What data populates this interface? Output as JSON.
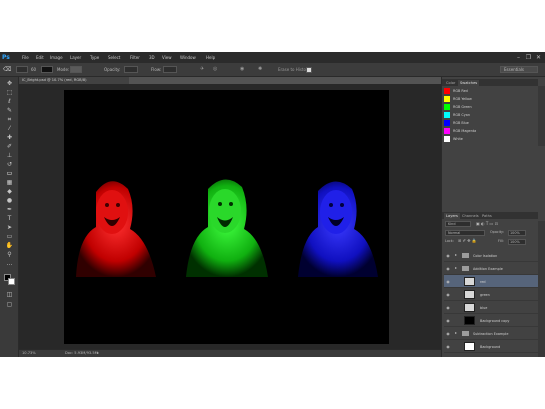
{
  "menu": {
    "items": [
      "File",
      "Edit",
      "Image",
      "Layer",
      "Type",
      "Select",
      "Filter",
      "3D",
      "View",
      "Window",
      "Help"
    ]
  },
  "window_controls": {
    "minimize": "–",
    "restore": "❐",
    "close": "✕"
  },
  "options": {
    "size_label": "60",
    "mode_label": "Mode:",
    "opacity_label": "Opacity:",
    "flow_label": "Flow:",
    "erase_history": "Erase to History",
    "workspace": "Essentials"
  },
  "document": {
    "tab_title": "IC_Bright.psd @ 10.7% (red, RGB/8)",
    "zoom": "10.73%",
    "doc_size": "Doc: 5.93M/93.5M",
    "faces": [
      {
        "name": "red",
        "color": "#ff1a1a"
      },
      {
        "name": "green",
        "color": "#22e022"
      },
      {
        "name": "blue",
        "color": "#2323ff"
      }
    ]
  },
  "swatches_panel": {
    "tabs": [
      "Color",
      "Swatches"
    ],
    "active_tab": "Swatches",
    "items": [
      {
        "label": "RGB Red",
        "color": "#ff0000"
      },
      {
        "label": "RGB Yellow",
        "color": "#ffff00"
      },
      {
        "label": "RGB Green",
        "color": "#00ff00"
      },
      {
        "label": "RGB Cyan",
        "color": "#00ffff"
      },
      {
        "label": "RGB Blue",
        "color": "#0000ff"
      },
      {
        "label": "RGB Magenta",
        "color": "#ff00ff"
      },
      {
        "label": "White",
        "color": "#ffffff"
      }
    ]
  },
  "layers_panel": {
    "tabs": [
      "Layers",
      "Channels",
      "Paths"
    ],
    "active_tab": "Layers",
    "kind_label": "Kind",
    "blend_mode": "Normal",
    "opacity_label": "Opacity:",
    "opacity_value": "100%",
    "lock_label": "Lock:",
    "fill_label": "Fill:",
    "fill_value": "100%",
    "layers": [
      {
        "name": "Color Isolation",
        "type": "group",
        "selected": false,
        "thumb": ""
      },
      {
        "name": "Addition Example",
        "type": "group",
        "selected": false,
        "thumb": ""
      },
      {
        "name": "red",
        "type": "layer",
        "selected": true,
        "thumb": "#d8d8d8"
      },
      {
        "name": "green",
        "type": "layer",
        "selected": false,
        "thumb": "#d8d8d8"
      },
      {
        "name": "blue",
        "type": "layer",
        "selected": false,
        "thumb": "#d8d8d8"
      },
      {
        "name": "Background copy",
        "type": "layer",
        "selected": false,
        "thumb": "#000000"
      },
      {
        "name": "Subtraction Example",
        "type": "group",
        "selected": false,
        "thumb": ""
      },
      {
        "name": "Background",
        "type": "layer",
        "selected": false,
        "thumb": "#ffffff"
      }
    ]
  }
}
